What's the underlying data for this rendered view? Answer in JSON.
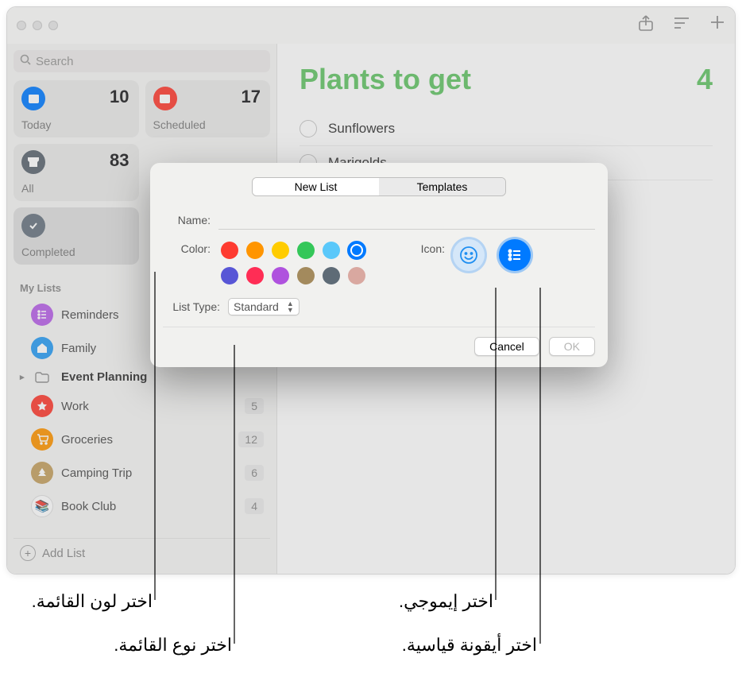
{
  "sidebar": {
    "search_placeholder": "Search",
    "cards": [
      {
        "label": "Today",
        "count": "10",
        "bg": "#007aff"
      },
      {
        "label": "Scheduled",
        "count": "17",
        "bg": "#fe3b30"
      },
      {
        "label": "All",
        "count": "83",
        "bg": "#5b6670"
      },
      {
        "label": "Completed",
        "count": "",
        "bg": "#687480"
      }
    ],
    "section_label": "My Lists",
    "lists": [
      {
        "label": "Reminders",
        "bg": "#b860e8",
        "icon": "list",
        "count": "",
        "bold": false,
        "chev": false
      },
      {
        "label": "Family",
        "bg": "#2a9df4",
        "icon": "home",
        "count": "",
        "bold": false,
        "chev": false
      },
      {
        "label": "Event Planning",
        "bg": "#f1f1ef",
        "icon": "folder",
        "count": "",
        "bold": true,
        "chev": true
      },
      {
        "label": "Work",
        "bg": "#fe3b30",
        "icon": "star",
        "count": "5",
        "bold": false,
        "chev": false
      },
      {
        "label": "Groceries",
        "bg": "#ff9500",
        "icon": "cart",
        "count": "12",
        "bold": false,
        "chev": false
      },
      {
        "label": "Camping Trip",
        "bg": "#c4a060",
        "icon": "tree",
        "count": "6",
        "bold": false,
        "chev": false
      },
      {
        "label": "Book Club",
        "bg": "#ffffff",
        "icon": "books",
        "count": "4",
        "bold": false,
        "chev": false
      }
    ],
    "add_list": "Add List"
  },
  "main": {
    "title": "Plants to get",
    "count": "4",
    "items": [
      "Sunflowers",
      "Marigolds"
    ]
  },
  "dialog": {
    "tabs": {
      "new_list": "New List",
      "templates": "Templates"
    },
    "name_label": "Name:",
    "color_label": "Color:",
    "icon_label": "Icon:",
    "list_type_label": "List Type:",
    "list_type_value": "Standard",
    "cancel": "Cancel",
    "ok": "OK",
    "colors": [
      "#fe3b30",
      "#ff9500",
      "#ffcc00",
      "#34c759",
      "#5ac8fa",
      "#007aff",
      "#5856d6",
      "#ff2d55",
      "#af52de",
      "#a38a5d",
      "#5e6b76",
      "#d9a8a0"
    ],
    "selected_color_index": 5
  },
  "callouts": {
    "choose_list_color": "اختر لون القائمة.",
    "choose_list_type": "اختر نوع القائمة.",
    "choose_emoji": "اختر إيموجي.",
    "choose_standard_icon": "اختر أيقونة قياسية."
  }
}
